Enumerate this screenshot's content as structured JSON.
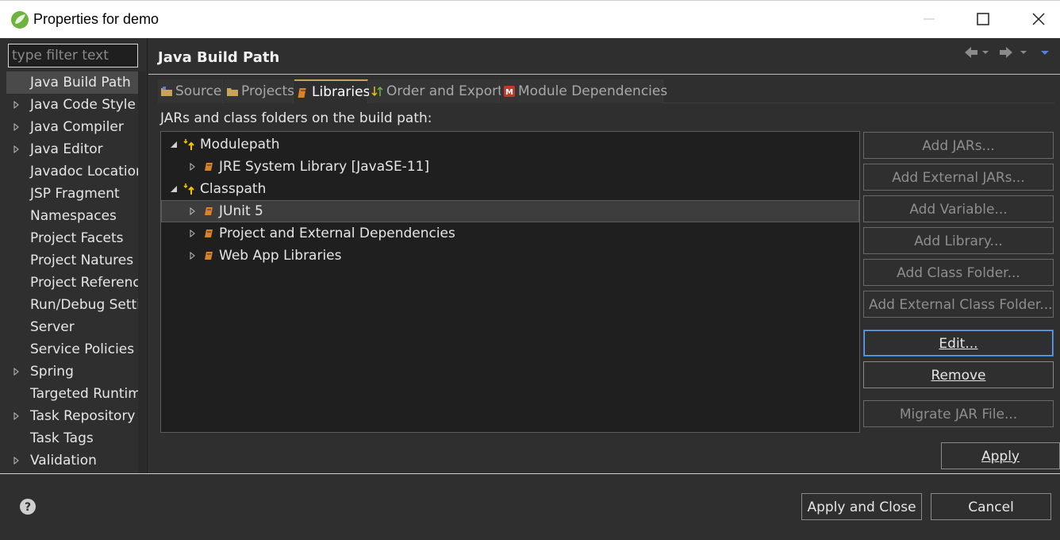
{
  "window": {
    "title": "Properties for demo"
  },
  "filter": {
    "placeholder": "type filter text"
  },
  "nav": {
    "items": [
      {
        "label": "Java Build Path",
        "expandable": false,
        "selected": true
      },
      {
        "label": "Java Code Style",
        "expandable": true
      },
      {
        "label": "Java Compiler",
        "expandable": true
      },
      {
        "label": "Java Editor",
        "expandable": true
      },
      {
        "label": "Javadoc Location",
        "expandable": false
      },
      {
        "label": "JSP Fragment",
        "expandable": false
      },
      {
        "label": "Namespaces",
        "expandable": false
      },
      {
        "label": "Project Facets",
        "expandable": false
      },
      {
        "label": "Project Natures",
        "expandable": false
      },
      {
        "label": "Project References",
        "expandable": false
      },
      {
        "label": "Run/Debug Settings",
        "expandable": false
      },
      {
        "label": "Server",
        "expandable": false
      },
      {
        "label": "Service Policies",
        "expandable": false
      },
      {
        "label": "Spring",
        "expandable": true
      },
      {
        "label": "Targeted Runtimes",
        "expandable": false
      },
      {
        "label": "Task Repository",
        "expandable": true
      },
      {
        "label": "Task Tags",
        "expandable": false
      },
      {
        "label": "Validation",
        "expandable": true
      }
    ]
  },
  "page": {
    "title": "Java Build Path",
    "section_label": "JARs and class folders on the build path:"
  },
  "tabs": [
    {
      "label": "Source",
      "icon": "source-folder-icon"
    },
    {
      "label": "Projects",
      "icon": "folder-icon"
    },
    {
      "label": "Libraries",
      "icon": "library-icon",
      "active": true
    },
    {
      "label": "Order and Export",
      "icon": "order-arrows-icon"
    },
    {
      "label": "Module Dependencies",
      "icon": "module-icon"
    }
  ],
  "tree": {
    "rows": [
      {
        "label": "Modulepath",
        "level": 0,
        "expanded": true,
        "icon": "modulepath-icon"
      },
      {
        "label": "JRE System Library [JavaSE-11]",
        "level": 1,
        "expanded": false,
        "icon": "library-icon"
      },
      {
        "label": "Classpath",
        "level": 0,
        "expanded": true,
        "icon": "classpath-icon"
      },
      {
        "label": "JUnit 5",
        "level": 1,
        "expanded": false,
        "icon": "library-icon",
        "selected": true
      },
      {
        "label": "Project and External Dependencies",
        "level": 1,
        "expanded": false,
        "icon": "library-icon"
      },
      {
        "label": "Web App Libraries",
        "level": 1,
        "expanded": false,
        "icon": "library-icon"
      }
    ]
  },
  "buttons": {
    "add_jars": "Add JARs...",
    "add_external_jars": "Add External JARs...",
    "add_variable": "Add Variable...",
    "add_library": "Add Library...",
    "add_class_folder": "Add Class Folder...",
    "add_external_class_folder": "Add External Class Folder...",
    "edit": "Edit...",
    "remove": "Remove",
    "migrate_jar": "Migrate JAR File...",
    "apply": "Apply",
    "apply_and_close": "Apply and Close",
    "cancel": "Cancel"
  },
  "colors": {
    "background": "#2f2f2f",
    "tree_background": "#1f1f1f",
    "active_tab_accent": "#c9a35a",
    "focus_border": "#3e7ccc",
    "library_icon": "#d9822b",
    "path_arrow": "#f2c200"
  }
}
